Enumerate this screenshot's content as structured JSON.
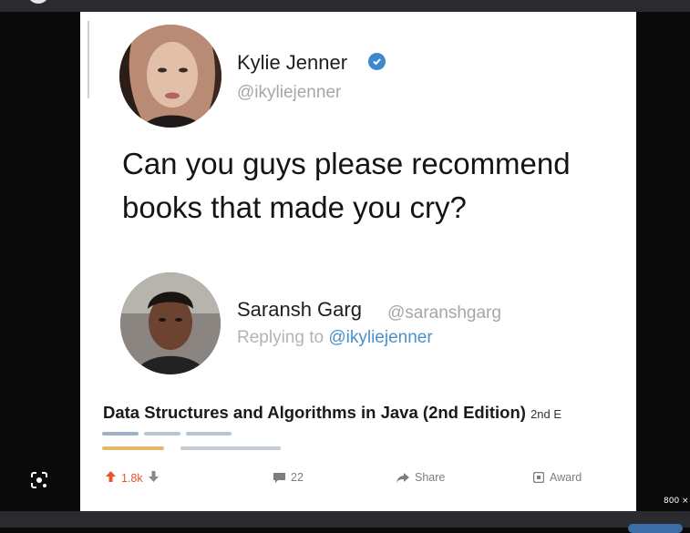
{
  "viewer": {
    "size_label": "800 ×"
  },
  "tweet": {
    "author_name": "Kylie Jenner",
    "author_handle": "@ikyliejenner",
    "text_line1": "Can you guys please recommend",
    "text_line2": "books that made you cry?"
  },
  "reply": {
    "author_name": "Saransh Garg",
    "author_handle": "@saranshgarg",
    "replying_prefix": "Replying to",
    "replying_mention": "@ikyliejenner"
  },
  "book": {
    "title": "Data Structures and Algorithms in Java (2nd Edition)",
    "edition_suffix": "2nd E"
  },
  "footer": {
    "upvotes": "1.8k",
    "comments": "22",
    "share_label": "Share",
    "award_label": "Award"
  },
  "colors": {
    "upvote": "#e8532b",
    "verified": "#3f88cf",
    "mention": "#4b91c9"
  }
}
